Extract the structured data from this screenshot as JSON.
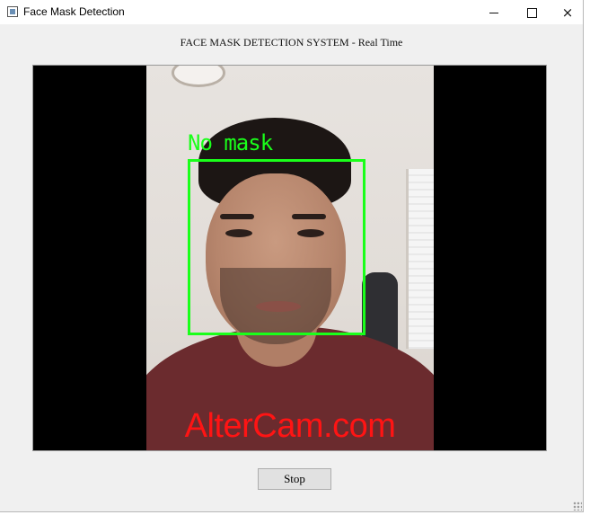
{
  "window": {
    "title": "Face Mask Detection",
    "controls": {
      "minimize": "minimize",
      "maximize": "maximize",
      "close": "×"
    }
  },
  "heading": "FACE MASK DETECTION SYSTEM - Real Time",
  "video": {
    "detection_label": "No mask",
    "detection_color": "#1aff1a",
    "watermark": "AlterCam.com",
    "watermark_color": "#ff1414"
  },
  "buttons": {
    "stop_label": "Stop"
  }
}
